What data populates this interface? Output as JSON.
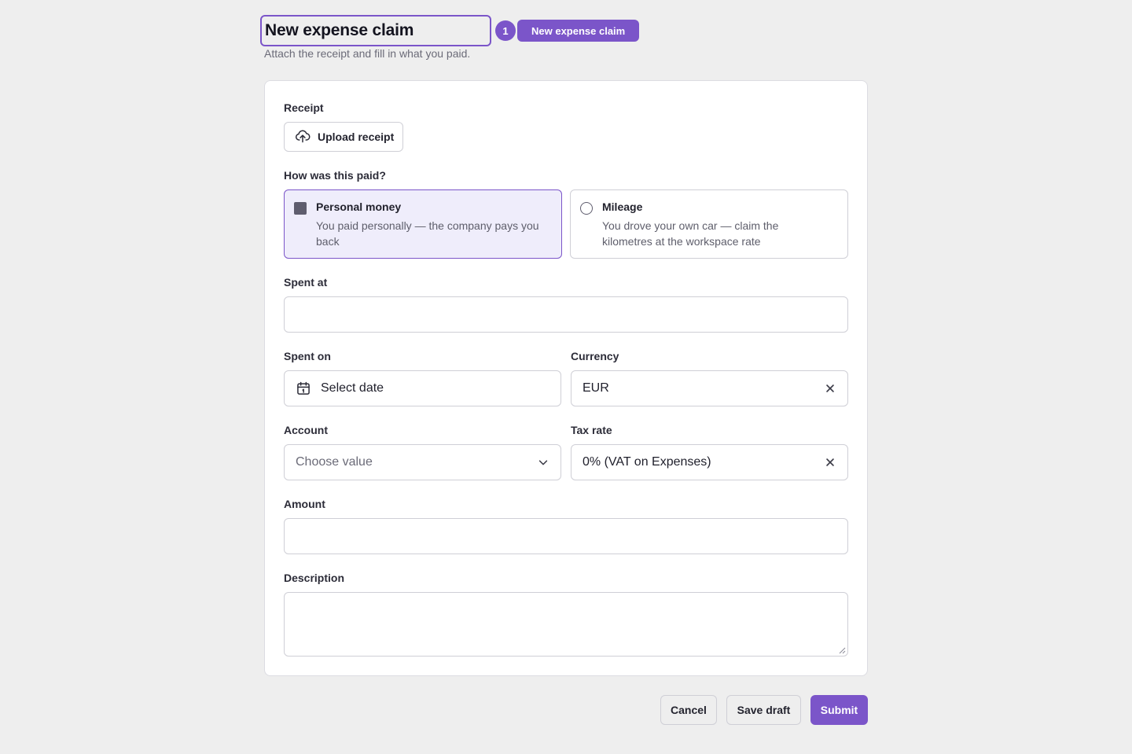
{
  "header": {
    "title": "New expense claim",
    "step_number": "1",
    "step_tag": "New expense claim",
    "subtitle": "Attach the receipt and fill in what you paid."
  },
  "form": {
    "receipt": {
      "label": "Receipt",
      "upload_button": "Upload receipt",
      "icon": "upload-cloud-icon"
    },
    "payment": {
      "label": "How was this paid?",
      "options": [
        {
          "title": "Personal money",
          "description": "You paid personally — the company pays you back",
          "selected": true
        },
        {
          "title": "Mileage",
          "description": "You drove your own car — claim the kilometres at the workspace rate",
          "selected": false
        }
      ]
    },
    "spent_at": {
      "label": "Spent at",
      "value": ""
    },
    "spent_on": {
      "label": "Spent on",
      "placeholder": "Select date",
      "icon": "calendar-icon"
    },
    "currency": {
      "label": "Currency",
      "value": "EUR"
    },
    "account": {
      "label": "Account",
      "placeholder": "Choose value"
    },
    "tax_rate": {
      "label": "Tax rate",
      "value": "0% (VAT on Expenses)"
    },
    "amount": {
      "label": "Amount",
      "value": ""
    },
    "description": {
      "label": "Description",
      "value": ""
    }
  },
  "actions": {
    "cancel": "Cancel",
    "save_draft": "Save draft",
    "submit": "Submit"
  },
  "colors": {
    "accent": "#7b55c9",
    "selected_bg": "#efedfb",
    "page_bg": "#eeeeee"
  }
}
